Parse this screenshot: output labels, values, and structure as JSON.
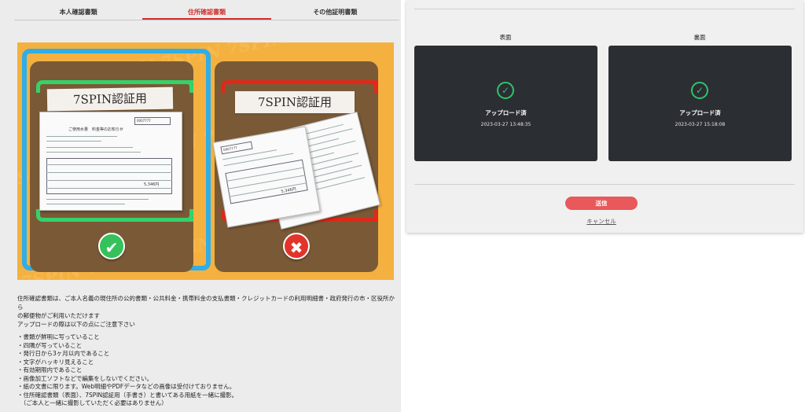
{
  "tabs": [
    {
      "label": "本人確認書類",
      "active": false
    },
    {
      "label": "住所確認書類",
      "active": true
    },
    {
      "label": "その他証明書類",
      "active": false
    }
  ],
  "example": {
    "good_tape": "7SPIN認証用",
    "bad_tape": "7SPIN認証用",
    "good_mark": "✔",
    "bad_mark": "✖",
    "doc_title": "ご使用水量　料金等のお知らせ",
    "doc_number": "0007777",
    "doc_amount": "5,346円"
  },
  "description": {
    "line1": "住所確認書類は、ご本人名義の現住所の公的書類・公共料金・携帯料金の支払書類・クレジットカードの利用明細書・政府発行の市・区役所から",
    "line2": "の郵便物がご利用いただけます",
    "line3": "アップロードの際は以下の点にご注意下さい"
  },
  "notes": [
    "・書類が鮮明に写っていること",
    "・四隅が写っていること",
    "・発行日から3ヶ月以内であること",
    "・文字がハッキリ見えること",
    "・有効期限内であること",
    "・画像加工ソフトなどで編集をしないでください。",
    "・紙の文書に限ります。Web明細やPDFデータなどの画像は受付けておりません。",
    "・住所確認書類（表面）、7SPIN認証用（手書き）と書いてある用紙を一緒に撮影。",
    "　（ご本人と一緒に撮影していただく必要はありません）"
  ],
  "upload": {
    "front_label": "表面",
    "back_label": "裏面",
    "front_status": "アップロード済",
    "front_time": "2023-03-27 13:48:35",
    "back_status": "アップロード済",
    "back_time": "2023-03-27 15:18:08",
    "submit_label": "送信",
    "cancel_label": "キャンセル"
  },
  "colors": {
    "accent_red": "#d0312d",
    "banner_orange": "#f5b13f",
    "ok_green": "#35c25a",
    "ng_red": "#e2342b",
    "card_dark": "#2b2e33",
    "submit_red": "#e9585a"
  },
  "icons": {
    "ok": "check-circle-icon",
    "ng": "cross-circle-icon",
    "uploaded": "check-circle-icon"
  }
}
